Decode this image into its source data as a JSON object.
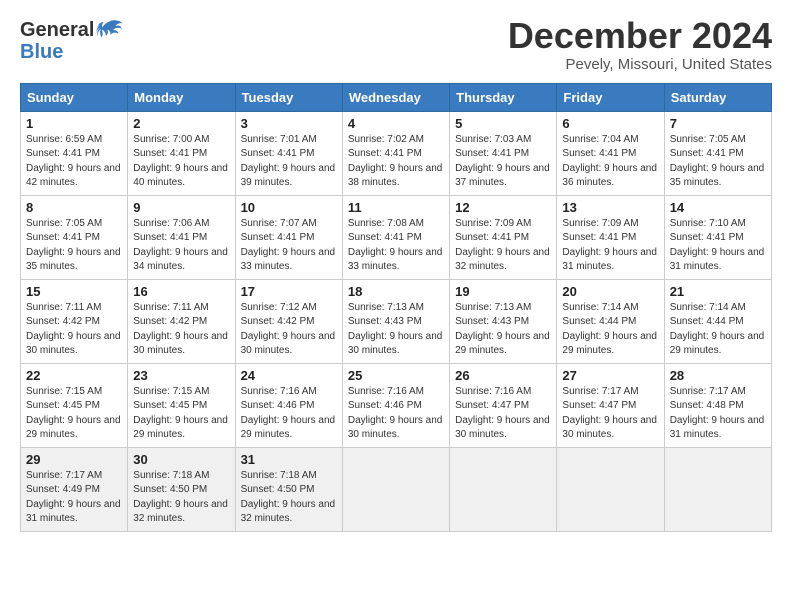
{
  "logo": {
    "line1": "General",
    "line2": "Blue"
  },
  "title": "December 2024",
  "location": "Pevely, Missouri, United States",
  "days_of_week": [
    "Sunday",
    "Monday",
    "Tuesday",
    "Wednesday",
    "Thursday",
    "Friday",
    "Saturday"
  ],
  "weeks": [
    [
      {
        "day": "1",
        "sunrise": "6:59 AM",
        "sunset": "4:41 PM",
        "daylight": "9 hours and 42 minutes."
      },
      {
        "day": "2",
        "sunrise": "7:00 AM",
        "sunset": "4:41 PM",
        "daylight": "9 hours and 40 minutes."
      },
      {
        "day": "3",
        "sunrise": "7:01 AM",
        "sunset": "4:41 PM",
        "daylight": "9 hours and 39 minutes."
      },
      {
        "day": "4",
        "sunrise": "7:02 AM",
        "sunset": "4:41 PM",
        "daylight": "9 hours and 38 minutes."
      },
      {
        "day": "5",
        "sunrise": "7:03 AM",
        "sunset": "4:41 PM",
        "daylight": "9 hours and 37 minutes."
      },
      {
        "day": "6",
        "sunrise": "7:04 AM",
        "sunset": "4:41 PM",
        "daylight": "9 hours and 36 minutes."
      },
      {
        "day": "7",
        "sunrise": "7:05 AM",
        "sunset": "4:41 PM",
        "daylight": "9 hours and 35 minutes."
      }
    ],
    [
      {
        "day": "8",
        "sunrise": "7:05 AM",
        "sunset": "4:41 PM",
        "daylight": "9 hours and 35 minutes."
      },
      {
        "day": "9",
        "sunrise": "7:06 AM",
        "sunset": "4:41 PM",
        "daylight": "9 hours and 34 minutes."
      },
      {
        "day": "10",
        "sunrise": "7:07 AM",
        "sunset": "4:41 PM",
        "daylight": "9 hours and 33 minutes."
      },
      {
        "day": "11",
        "sunrise": "7:08 AM",
        "sunset": "4:41 PM",
        "daylight": "9 hours and 33 minutes."
      },
      {
        "day": "12",
        "sunrise": "7:09 AM",
        "sunset": "4:41 PM",
        "daylight": "9 hours and 32 minutes."
      },
      {
        "day": "13",
        "sunrise": "7:09 AM",
        "sunset": "4:41 PM",
        "daylight": "9 hours and 31 minutes."
      },
      {
        "day": "14",
        "sunrise": "7:10 AM",
        "sunset": "4:41 PM",
        "daylight": "9 hours and 31 minutes."
      }
    ],
    [
      {
        "day": "15",
        "sunrise": "7:11 AM",
        "sunset": "4:42 PM",
        "daylight": "9 hours and 30 minutes."
      },
      {
        "day": "16",
        "sunrise": "7:11 AM",
        "sunset": "4:42 PM",
        "daylight": "9 hours and 30 minutes."
      },
      {
        "day": "17",
        "sunrise": "7:12 AM",
        "sunset": "4:42 PM",
        "daylight": "9 hours and 30 minutes."
      },
      {
        "day": "18",
        "sunrise": "7:13 AM",
        "sunset": "4:43 PM",
        "daylight": "9 hours and 30 minutes."
      },
      {
        "day": "19",
        "sunrise": "7:13 AM",
        "sunset": "4:43 PM",
        "daylight": "9 hours and 29 minutes."
      },
      {
        "day": "20",
        "sunrise": "7:14 AM",
        "sunset": "4:44 PM",
        "daylight": "9 hours and 29 minutes."
      },
      {
        "day": "21",
        "sunrise": "7:14 AM",
        "sunset": "4:44 PM",
        "daylight": "9 hours and 29 minutes."
      }
    ],
    [
      {
        "day": "22",
        "sunrise": "7:15 AM",
        "sunset": "4:45 PM",
        "daylight": "9 hours and 29 minutes."
      },
      {
        "day": "23",
        "sunrise": "7:15 AM",
        "sunset": "4:45 PM",
        "daylight": "9 hours and 29 minutes."
      },
      {
        "day": "24",
        "sunrise": "7:16 AM",
        "sunset": "4:46 PM",
        "daylight": "9 hours and 29 minutes."
      },
      {
        "day": "25",
        "sunrise": "7:16 AM",
        "sunset": "4:46 PM",
        "daylight": "9 hours and 30 minutes."
      },
      {
        "day": "26",
        "sunrise": "7:16 AM",
        "sunset": "4:47 PM",
        "daylight": "9 hours and 30 minutes."
      },
      {
        "day": "27",
        "sunrise": "7:17 AM",
        "sunset": "4:47 PM",
        "daylight": "9 hours and 30 minutes."
      },
      {
        "day": "28",
        "sunrise": "7:17 AM",
        "sunset": "4:48 PM",
        "daylight": "9 hours and 31 minutes."
      }
    ],
    [
      {
        "day": "29",
        "sunrise": "7:17 AM",
        "sunset": "4:49 PM",
        "daylight": "9 hours and 31 minutes."
      },
      {
        "day": "30",
        "sunrise": "7:18 AM",
        "sunset": "4:50 PM",
        "daylight": "9 hours and 32 minutes."
      },
      {
        "day": "31",
        "sunrise": "7:18 AM",
        "sunset": "4:50 PM",
        "daylight": "9 hours and 32 minutes."
      },
      null,
      null,
      null,
      null
    ]
  ],
  "labels": {
    "sunrise_prefix": "Sunrise: ",
    "sunset_prefix": "Sunset: ",
    "daylight_prefix": "Daylight: "
  }
}
